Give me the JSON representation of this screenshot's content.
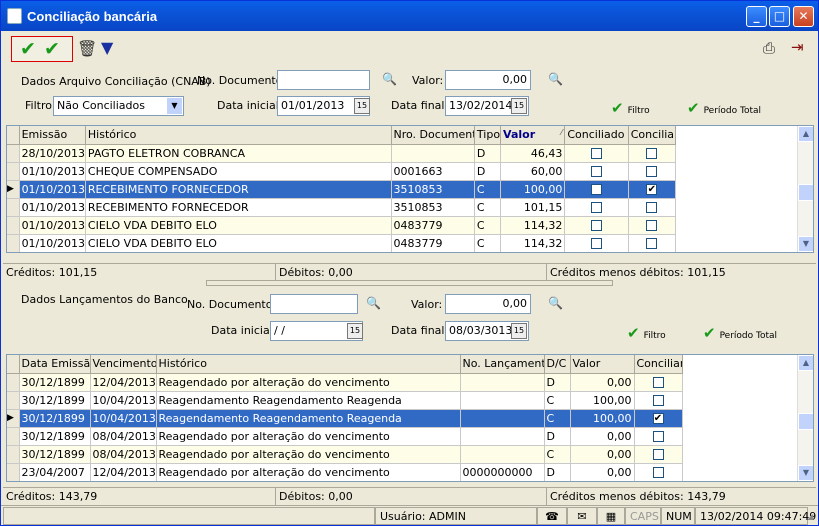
{
  "window": {
    "title": "Conciliação bancária"
  },
  "arquivo": {
    "section_label": "Dados Arquivo Conciliação (CNAB)",
    "nodoc_label": "No. Documento:",
    "nodoc_value": "",
    "valor_label": "Valor:",
    "valor_value": "0,00",
    "filtro_label": "Filtro",
    "filtro_value": "Não Conciliados",
    "data_inicial_label": "Data inicial:",
    "data_inicial_value": "01/01/2013",
    "data_final_label": "Data final:",
    "data_final_value": "13/02/2014",
    "filtro_btn": "Filtro",
    "periodo_btn": "Período Total",
    "columns": [
      "Emissão",
      "Histórico",
      "Nro. Documento",
      "Tipo",
      "Valor",
      "Conciliado",
      "Conciliar"
    ],
    "rows": [
      {
        "emissao": "28/10/2013",
        "historico": "PAGTO ELETRON  COBRANCA",
        "doc": "",
        "tipo": "D",
        "valor": "46,43",
        "conciliado": false,
        "conciliar": false
      },
      {
        "emissao": "01/10/2013",
        "historico": "CHEQUE COMPENSADO",
        "doc": "0001663",
        "tipo": "D",
        "valor": "60,00",
        "conciliado": false,
        "conciliar": false
      },
      {
        "emissao": "01/10/2013",
        "historico": "RECEBIMENTO FORNECEDOR",
        "doc": "3510853",
        "tipo": "C",
        "valor": "100,00",
        "conciliado": false,
        "conciliar": true
      },
      {
        "emissao": "01/10/2013",
        "historico": "RECEBIMENTO FORNECEDOR",
        "doc": "3510853",
        "tipo": "C",
        "valor": "101,15",
        "conciliado": false,
        "conciliar": false
      },
      {
        "emissao": "01/10/2013",
        "historico": "CIELO VDA DEBITO ELO",
        "doc": "0483779",
        "tipo": "C",
        "valor": "114,32",
        "conciliado": false,
        "conciliar": false
      },
      {
        "emissao": "01/10/2013",
        "historico": "CIELO VDA DEBITO ELO",
        "doc": "0483779",
        "tipo": "C",
        "valor": "114,32",
        "conciliado": false,
        "conciliar": false
      }
    ],
    "creditos": "Créditos: 101,15",
    "debitos": "Débitos: 0,00",
    "saldo": "Créditos menos débitos: 101,15"
  },
  "banco": {
    "section_label": "Dados Lançamentos do Banco",
    "nodoc_label": "No. Documento:",
    "nodoc_value": "",
    "valor_label": "Valor:",
    "valor_value": "0,00",
    "data_inicial_label": "Data inicial:",
    "data_inicial_value": " / /",
    "data_final_label": "Data final:",
    "data_final_value": "08/03/3013",
    "filtro_btn": "Filtro",
    "periodo_btn": "Período Total",
    "columns": [
      "Data Emissão",
      "Vencimento",
      "Histórico",
      "No. Lançamento",
      "D/C",
      "Valor",
      "Conciliar"
    ],
    "rows": [
      {
        "emissao": "30/12/1899",
        "venc": "12/04/2013",
        "historico": "Reagendado por alteração do vencimento",
        "lanc": "",
        "dc": "D",
        "valor": "0,00",
        "conciliar": false
      },
      {
        "emissao": "30/12/1899",
        "venc": "10/04/2013",
        "historico": "Reagendamento Reagendamento Reagenda",
        "lanc": "",
        "dc": "C",
        "valor": "100,00",
        "conciliar": false
      },
      {
        "emissao": "30/12/1899",
        "venc": "10/04/2013",
        "historico": "Reagendamento Reagendamento Reagenda",
        "lanc": "",
        "dc": "C",
        "valor": "100,00",
        "conciliar": true
      },
      {
        "emissao": "30/12/1899",
        "venc": "08/04/2013",
        "historico": "Reagendado por alteração do vencimento",
        "lanc": "",
        "dc": "D",
        "valor": "0,00",
        "conciliar": false
      },
      {
        "emissao": "30/12/1899",
        "venc": "08/04/2013",
        "historico": "Reagendado por alteração do vencimento",
        "lanc": "",
        "dc": "C",
        "valor": "0,00",
        "conciliar": false
      },
      {
        "emissao": "23/04/2007",
        "venc": "12/04/2013",
        "historico": "Reagendado por alteração do vencimento",
        "lanc": "0000000000",
        "dc": "D",
        "valor": "0,00",
        "conciliar": false
      }
    ],
    "creditos": "Créditos: 143,79",
    "debitos": "Débitos: 0,00",
    "saldo": "Créditos menos débitos: 143,79"
  },
  "statusbar": {
    "usuario": "Usuário: ADMIN",
    "caps": "CAPS",
    "num": "NUM",
    "datetime": "13/02/2014 09:47:49"
  },
  "colors": {
    "titlebar": "#0a5fe8",
    "selection": "#316ac5",
    "check_green": "#1a9a1a",
    "alt_row": "#fefde8"
  }
}
